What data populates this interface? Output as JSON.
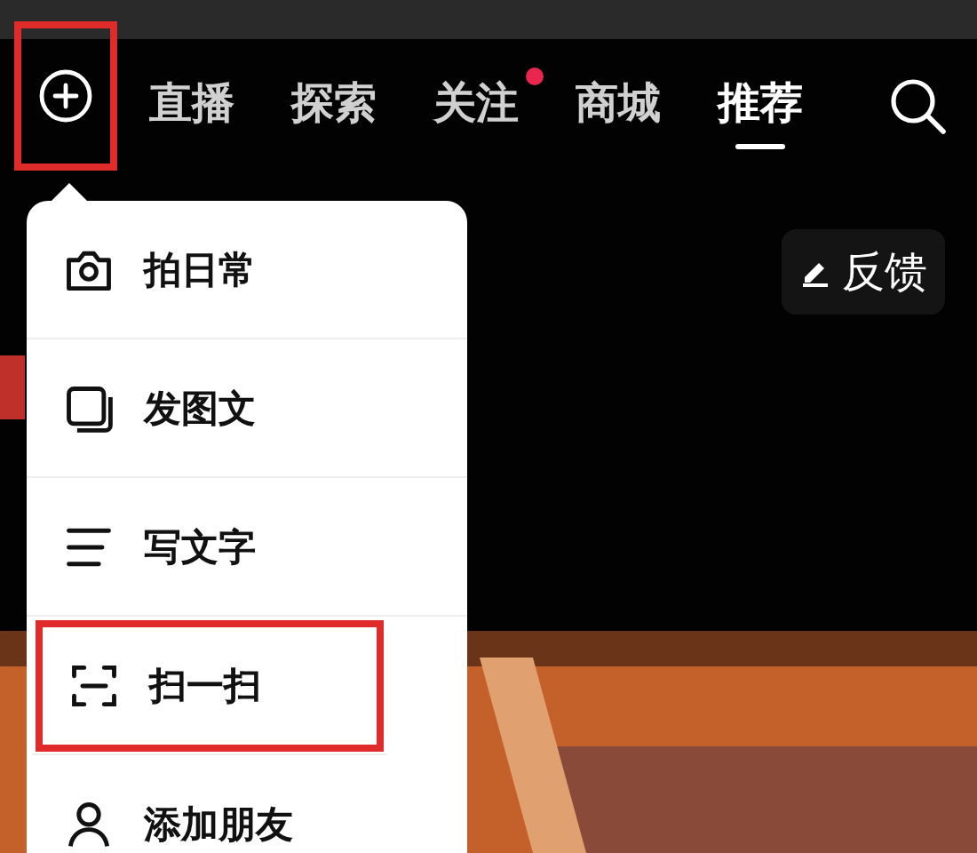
{
  "top_bar": {
    "add_button": {
      "highlighted": true
    },
    "tabs": [
      {
        "label": "直播",
        "selected": false,
        "dot": false
      },
      {
        "label": "探索",
        "selected": false,
        "dot": false
      },
      {
        "label": "关注",
        "selected": false,
        "dot": true
      },
      {
        "label": "商城",
        "selected": false,
        "dot": false
      },
      {
        "label": "推荐",
        "selected": true,
        "dot": false
      }
    ]
  },
  "feedback_button": {
    "label": "反馈"
  },
  "menu": {
    "items": [
      {
        "kind": "camera",
        "label": "拍日常",
        "highlighted": false
      },
      {
        "kind": "gallery",
        "label": "发图文",
        "highlighted": false
      },
      {
        "kind": "text",
        "label": "写文字",
        "highlighted": false
      },
      {
        "kind": "scan",
        "label": "扫一扫",
        "highlighted": true
      },
      {
        "kind": "person",
        "label": "添加朋友",
        "highlighted": false
      }
    ]
  }
}
